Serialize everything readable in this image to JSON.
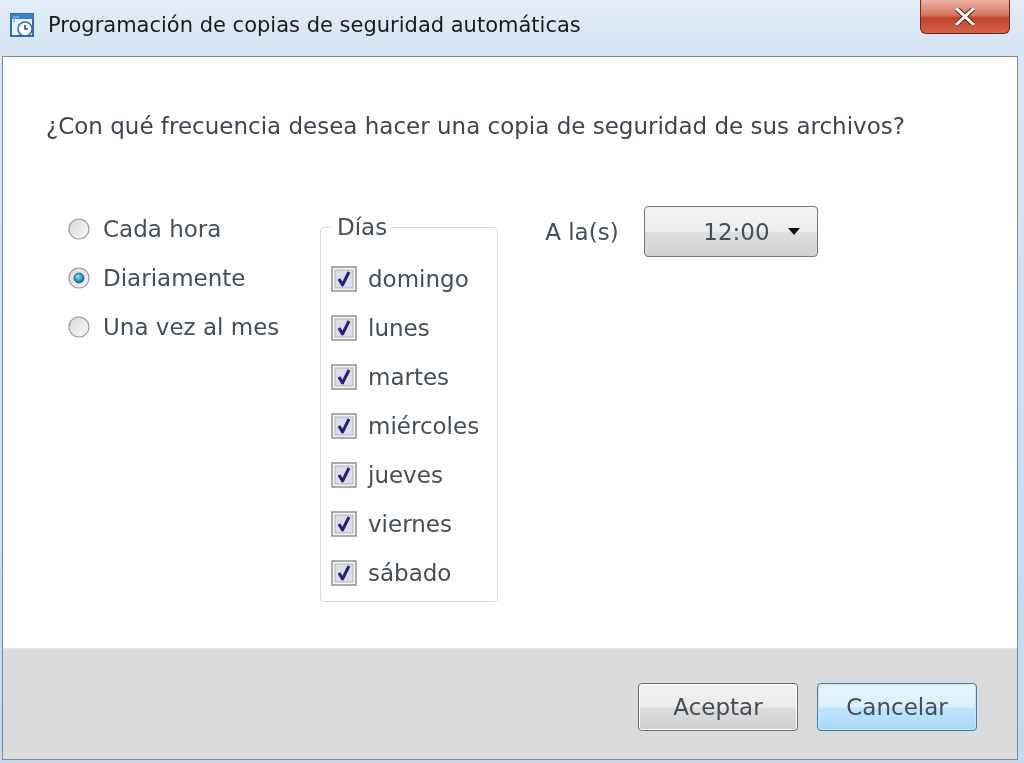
{
  "window": {
    "title": "Programación de copias de seguridad automáticas"
  },
  "question": "¿Con qué frecuencia desea hacer una copia de seguridad de sus archivos?",
  "frequency_options": [
    {
      "label": "Cada hora",
      "selected": false
    },
    {
      "label": "Diariamente",
      "selected": true
    },
    {
      "label": "Una vez al mes",
      "selected": false
    }
  ],
  "days_group": {
    "title": "Días",
    "days": [
      {
        "label": "domingo",
        "checked": true
      },
      {
        "label": "lunes",
        "checked": true
      },
      {
        "label": "martes",
        "checked": true
      },
      {
        "label": "miércoles",
        "checked": true
      },
      {
        "label": "jueves",
        "checked": true
      },
      {
        "label": "viernes",
        "checked": true
      },
      {
        "label": "sábado",
        "checked": true
      }
    ]
  },
  "time": {
    "label": "A la(s)",
    "value": "12:00"
  },
  "buttons": [
    {
      "label": "Aceptar",
      "focused": false
    },
    {
      "label": "Cancelar",
      "focused": true
    }
  ]
}
